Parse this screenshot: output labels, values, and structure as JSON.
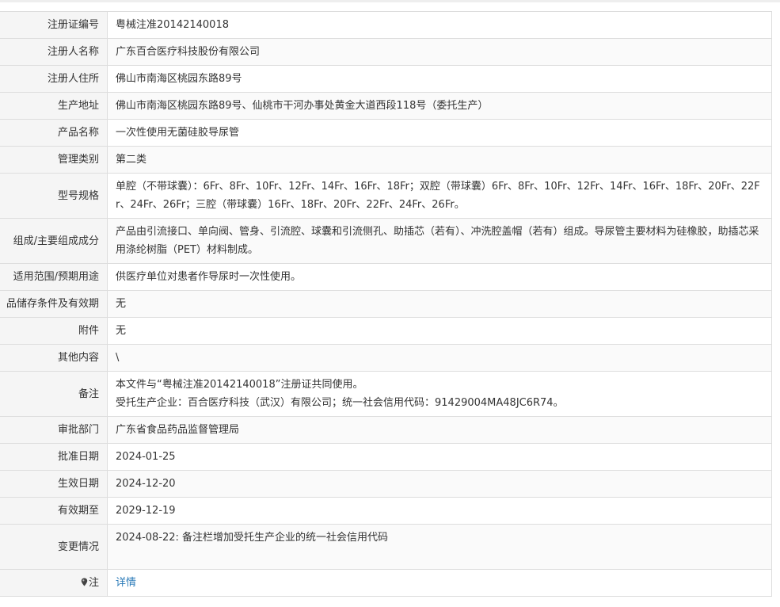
{
  "rows": [
    {
      "label": "注册证编号",
      "value": "粤械注准20142140018"
    },
    {
      "label": "注册人名称",
      "value": "广东百合医疗科技股份有限公司"
    },
    {
      "label": "注册人住所",
      "value": "佛山市南海区桃园东路89号"
    },
    {
      "label": "生产地址",
      "value": "佛山市南海区桃园东路89号、仙桃市干河办事处黄金大道西段118号（委托生产）"
    },
    {
      "label": "产品名称",
      "value": "一次性使用无菌硅胶导尿管"
    },
    {
      "label": "管理类别",
      "value": "第二类"
    },
    {
      "label": "型号规格",
      "value": "单腔（不带球囊）：6Fr、8Fr、10Fr、12Fr、14Fr、16Fr、18Fr；双腔（带球囊）6Fr、8Fr、10Fr、12Fr、14Fr、16Fr、18Fr、20Fr、22Fr、24Fr、26Fr；三腔（带球囊）16Fr、18Fr、20Fr、22Fr、24Fr、26Fr。"
    },
    {
      "label": "组成/主要组成成分",
      "value": "产品由引流接口、单向阀、管身、引流腔、球囊和引流侧孔、助插芯（若有）、冲洗腔盖帽（若有）组成。导尿管主要材料为硅橡胶，助插芯采用涤纶树脂（PET）材料制成。"
    },
    {
      "label": "适用范围/预期用途",
      "value": "供医疗单位对患者作导尿时一次性使用。"
    },
    {
      "label": "品储存条件及有效期",
      "value": "无"
    },
    {
      "label": "附件",
      "value": "无"
    },
    {
      "label": "其他内容",
      "value": "\\"
    },
    {
      "label": "备注",
      "lines": [
        "本文件与“粤械注准20142140018”注册证共同使用。",
        "受托生产企业：百合医疗科技（武汉）有限公司；统一社会信用代码：91429004MA48JC6R74。"
      ]
    },
    {
      "label": "审批部门",
      "value": "广东省食品药品监督管理局"
    },
    {
      "label": "批准日期",
      "value": "2024-01-25"
    },
    {
      "label": "生效日期",
      "value": "2024-12-20"
    },
    {
      "label": "有效期至",
      "value": "2029-12-19"
    },
    {
      "label": "变更情况",
      "value": "2024-08-22: 备注栏增加受托生产企业的统一社会信用代码"
    },
    {
      "label": "注",
      "icon": "pin-icon",
      "link": "详情"
    }
  ],
  "colors": {
    "label_bg": "#f5f5f5",
    "border": "#dddddd",
    "link": "#2a7ab8"
  }
}
